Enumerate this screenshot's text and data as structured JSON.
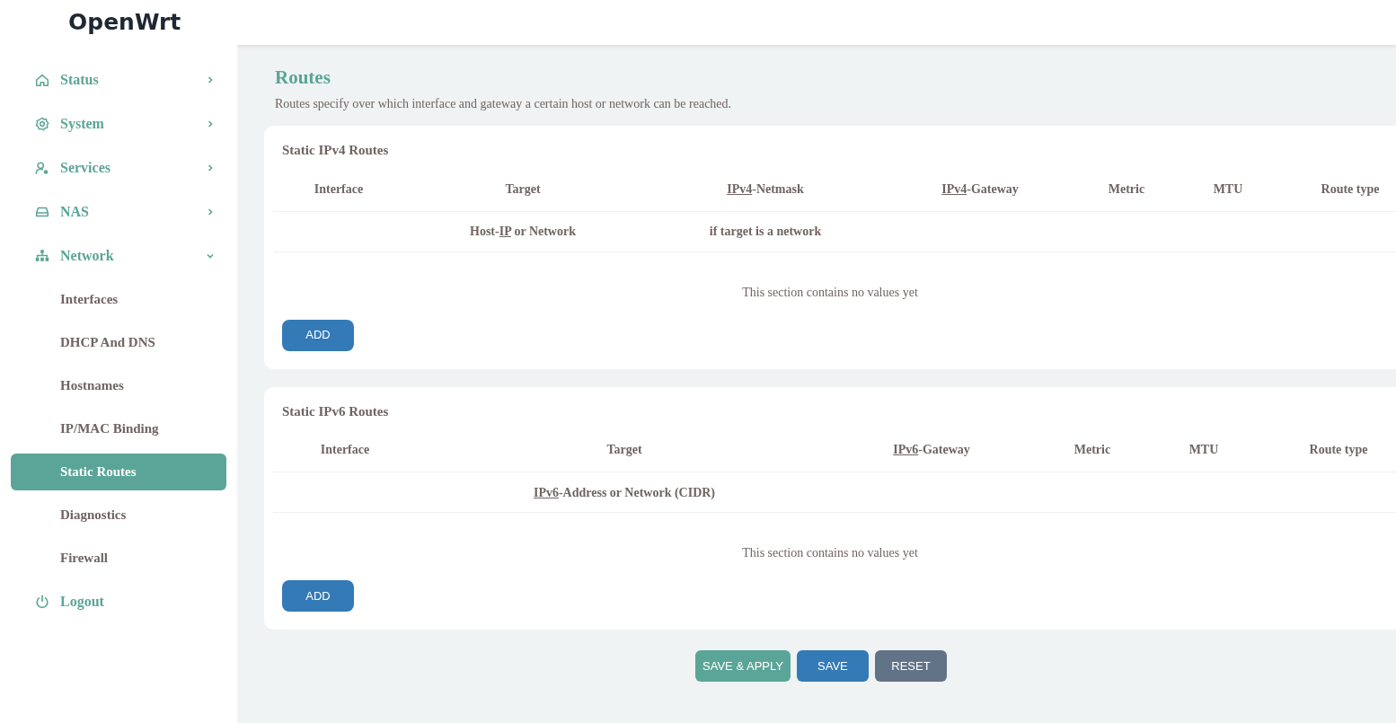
{
  "logo": "OpenWrt",
  "sidebar": {
    "items": [
      {
        "label": "Status",
        "kind": "menu",
        "expanded": false
      },
      {
        "label": "System",
        "kind": "menu",
        "expanded": false
      },
      {
        "label": "Services",
        "kind": "menu",
        "expanded": false
      },
      {
        "label": "NAS",
        "kind": "menu",
        "expanded": false
      },
      {
        "label": "Network",
        "kind": "menu",
        "expanded": true,
        "children": [
          {
            "label": "Interfaces",
            "selected": false
          },
          {
            "label": "DHCP And DNS",
            "selected": false
          },
          {
            "label": "Hostnames",
            "selected": false
          },
          {
            "label": "IP/MAC Binding",
            "selected": false
          },
          {
            "label": "Static Routes",
            "selected": true
          },
          {
            "label": "Diagnostics",
            "selected": false
          },
          {
            "label": "Firewall",
            "selected": false
          }
        ]
      },
      {
        "label": "Logout",
        "kind": "link"
      }
    ]
  },
  "page": {
    "title": "Routes",
    "description": "Routes specify over which interface and gateway a certain host or network can be reached."
  },
  "sections": [
    {
      "title": "Static IPv4 Routes",
      "columns": [
        {
          "header": [
            {
              "text": "Interface",
              "abbr": false
            }
          ]
        },
        {
          "header": [
            {
              "text": "Target",
              "abbr": false
            }
          ],
          "hint": [
            {
              "text": "Host-",
              "abbr": false
            },
            {
              "text": "IP",
              "abbr": true
            },
            {
              "text": " or Network",
              "abbr": false
            }
          ]
        },
        {
          "header": [
            {
              "text": "IPv4",
              "abbr": true
            },
            {
              "text": "-Netmask",
              "abbr": false
            }
          ],
          "hint": [
            {
              "text": "if target is a network",
              "abbr": false
            }
          ]
        },
        {
          "header": [
            {
              "text": "IPv4",
              "abbr": true
            },
            {
              "text": "-Gateway",
              "abbr": false
            }
          ]
        },
        {
          "header": [
            {
              "text": "Metric",
              "abbr": false
            }
          ]
        },
        {
          "header": [
            {
              "text": "MTU",
              "abbr": false
            }
          ]
        },
        {
          "header": [
            {
              "text": "Route type",
              "abbr": false
            }
          ]
        }
      ],
      "empty_message": "This section contains no values yet",
      "add_button": "ADD"
    },
    {
      "title": "Static IPv6 Routes",
      "columns": [
        {
          "header": [
            {
              "text": "Interface",
              "abbr": false
            }
          ]
        },
        {
          "header": [
            {
              "text": "Target",
              "abbr": false
            }
          ],
          "hint": [
            {
              "text": "IPv6",
              "abbr": true
            },
            {
              "text": "-Address or Network (CIDR)",
              "abbr": false
            }
          ]
        },
        {
          "header": [
            {
              "text": "IPv6",
              "abbr": true
            },
            {
              "text": "-Gateway",
              "abbr": false
            }
          ]
        },
        {
          "header": [
            {
              "text": "Metric",
              "abbr": false
            }
          ]
        },
        {
          "header": [
            {
              "text": "MTU",
              "abbr": false
            }
          ]
        },
        {
          "header": [
            {
              "text": "Route type",
              "abbr": false
            }
          ]
        }
      ],
      "empty_message": "This section contains no values yet",
      "add_button": "ADD"
    }
  ],
  "actions": [
    {
      "label": "SAVE & APPLY",
      "kind": "apply"
    },
    {
      "label": "SAVE",
      "kind": "save"
    },
    {
      "label": "RESET",
      "kind": "reset"
    }
  ]
}
